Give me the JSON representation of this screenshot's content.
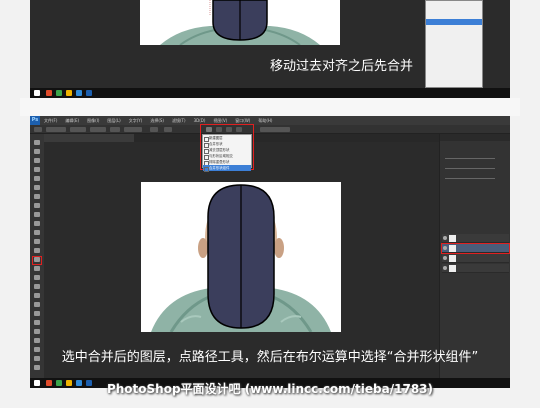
{
  "shot1": {
    "caption": "移动过去对齐之后先合并",
    "menu_items": [
      "",
      "",
      "",
      "",
      "",
      "",
      "",
      "",
      "",
      "",
      "",
      "",
      ""
    ],
    "clock": {
      "time": "",
      "date": ""
    }
  },
  "shot2": {
    "menubar": {
      "logo": "Ps",
      "items": [
        "文件(F)",
        "编辑(E)",
        "图像(I)",
        "图层(L)",
        "文字(Y)",
        "选择(S)",
        "滤镜(T)",
        "3D(D)",
        "视图(V)",
        "窗口(W)",
        "帮助(H)"
      ]
    },
    "document_tab": "",
    "boolean_dropdown": {
      "options": [
        "新建图层",
        "合并形状",
        "减去顶层形状",
        "与形状区域相交",
        "排除重叠形状",
        "合并形状组件"
      ],
      "selected_index": 5
    },
    "panels": {
      "tabs": [
        "",
        "",
        ""
      ],
      "properties_label": "",
      "layers": [
        {
          "name": "",
          "selected": false
        },
        {
          "name": "",
          "selected": true
        },
        {
          "name": "",
          "selected": false
        },
        {
          "name": "",
          "selected": false
        }
      ]
    },
    "caption": "选中合并后的图层，点路径工具，然后在布尔运算中选择“合并形状组件”",
    "clock": {
      "time": "",
      "date": ""
    }
  },
  "watermark": "PhotoShop平面设计吧  (www.lincc.com/tieba/1783)",
  "colors": {
    "ps_background": "#2b2b2b",
    "highlight_red": "#e02020",
    "shape_fill": "#3b3e5c",
    "shirt": "#8fb3a6",
    "menu_select": "#3c7fd6"
  }
}
